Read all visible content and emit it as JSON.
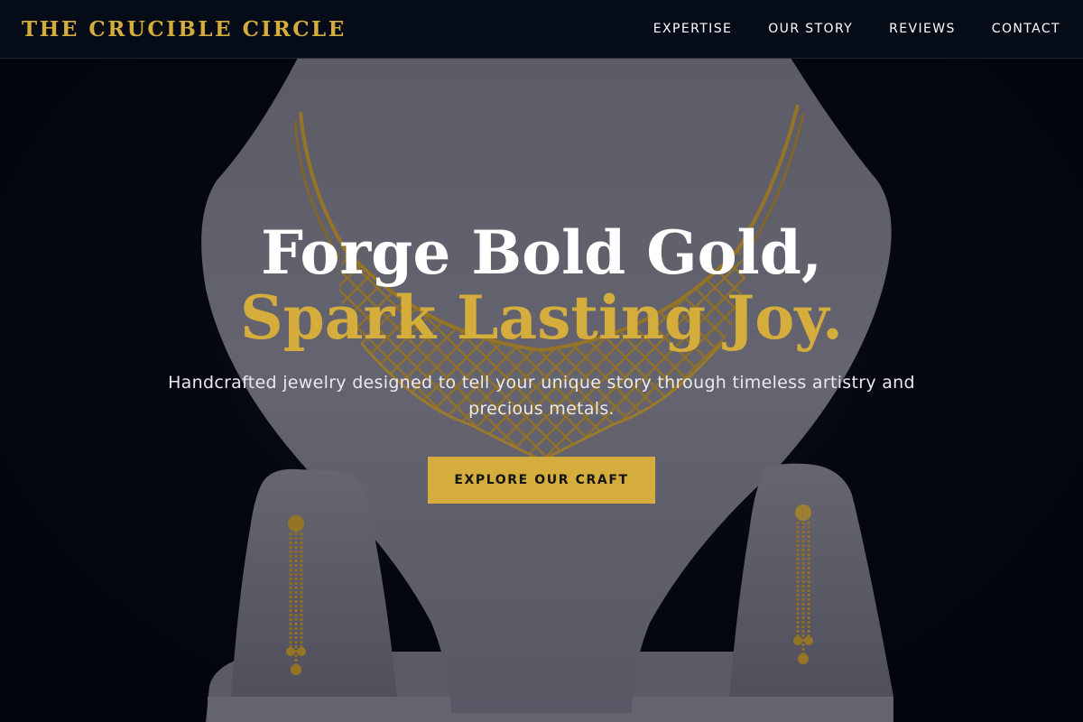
{
  "header": {
    "brand": "THE CRUCIBLE CIRCLE",
    "nav": [
      "EXPERTISE",
      "OUR STORY",
      "REVIEWS",
      "CONTACT"
    ]
  },
  "hero": {
    "headline_line1": "Forge Bold Gold,",
    "headline_line2": "Spark Lasting Joy.",
    "subtitle": "Handcrafted jewelry designed to tell your unique story through timeless artistry and precious metals.",
    "cta_label": "EXPLORE OUR CRAFT",
    "image_subject": "gold necklace and earrings on white display bust"
  },
  "colors": {
    "accent_gold": "#d4ad3c",
    "header_bg": "#070c1a",
    "text_white": "#ffffff"
  }
}
